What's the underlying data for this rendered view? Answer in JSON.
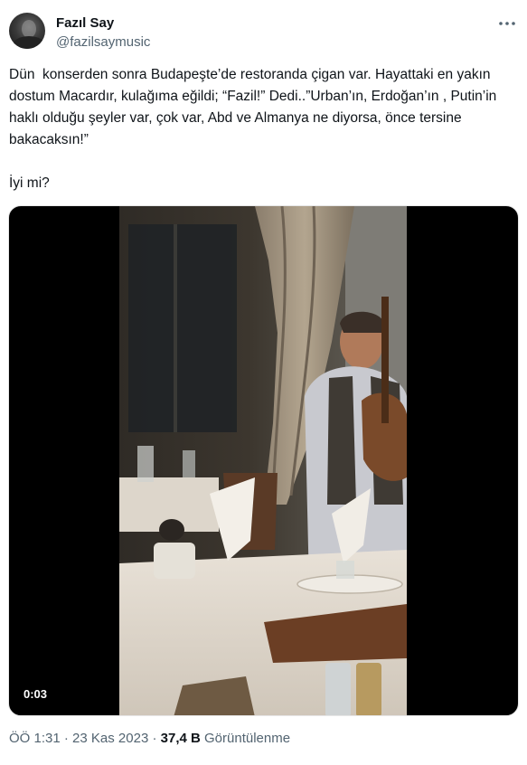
{
  "author": {
    "name": "Fazıl Say",
    "handle": "@fazilsaymusic"
  },
  "more_icon": "more-horizontal-icon",
  "tweet": {
    "text": "Dün  konserden sonra Budapeşte’de restoranda çigan var. Hayattaki en yakın dostum Macardır, kulağıma eğildi; “Fazil!” Dedi..”Urban’ın, Erdoğan’ın , Putin’in haklı olduğu şeyler var, çok var, Abd ve Almanya ne diyorsa, önce tersine bakacaksın!”\n\nİyi mi?"
  },
  "video": {
    "duration": "0:03"
  },
  "meta": {
    "time": "ÖÖ 1:31",
    "separator": "·",
    "date": "23 Kas 2023",
    "views_count": "37,4 B",
    "views_label": "Görüntülenme"
  },
  "colors": {
    "text_primary": "#0f1419",
    "text_secondary": "#536471",
    "video_letterbox": "#000000"
  }
}
